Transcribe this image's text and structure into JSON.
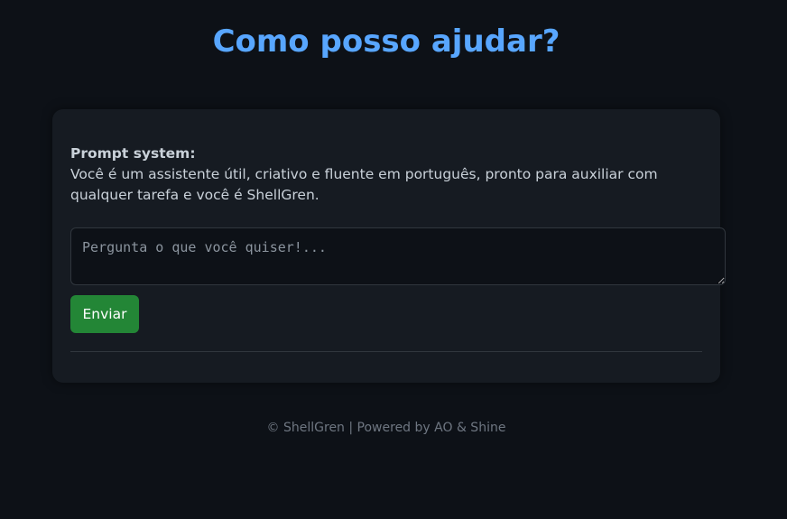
{
  "header": {
    "title": "Como posso ajudar?"
  },
  "system_prompt": {
    "label": "Prompt system:",
    "text": "Você é um assistente útil, criativo e fluente em português, pronto para auxiliar com qualquer tarefa e você é ShellGren."
  },
  "input": {
    "placeholder": "Pergunta o que você quiser!...",
    "value": ""
  },
  "actions": {
    "send_label": "Enviar"
  },
  "footer": {
    "text": "© ShellGren | Powered by AO & Shine"
  },
  "colors": {
    "background": "#0d1117",
    "card": "#161b22",
    "accent": "#58a6ff",
    "button": "#238636",
    "border": "#30363d"
  }
}
